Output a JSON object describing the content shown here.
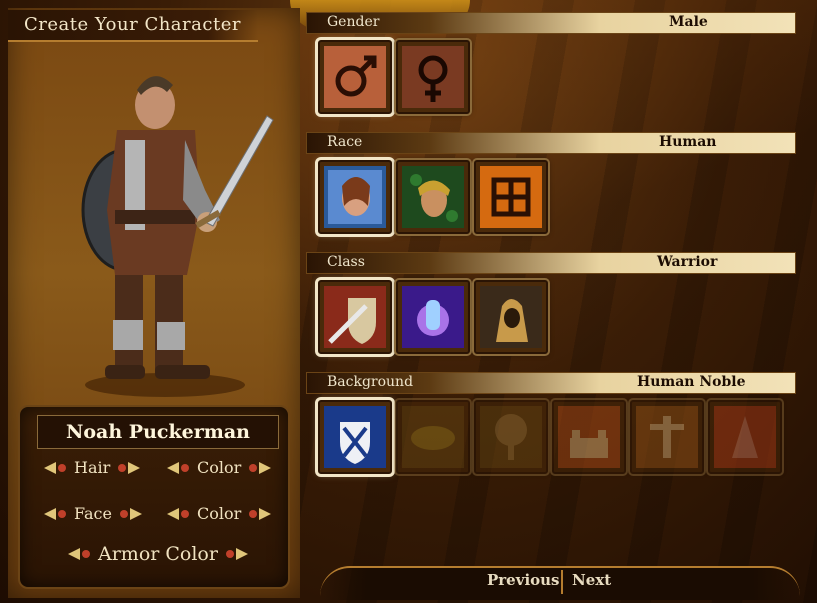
{
  "header": {
    "title": "Create Your Character"
  },
  "character": {
    "name": "Noah Puckerman",
    "options": {
      "hair": "Hair",
      "hair_color": "Color",
      "face": "Face",
      "face_color": "Color",
      "armor_color": "Armor Color"
    }
  },
  "sections": {
    "gender": {
      "label": "Gender",
      "value": "Male",
      "icons": [
        "male-symbol-icon",
        "female-symbol-icon"
      ],
      "selected": 0
    },
    "race": {
      "label": "Race",
      "value": "Human",
      "icons": [
        "human-portrait-icon",
        "elf-portrait-icon",
        "dwarf-portrait-icon"
      ],
      "selected": 0
    },
    "class": {
      "label": "Class",
      "value": "Warrior",
      "icons": [
        "sword-shield-icon",
        "magic-hand-icon",
        "hooded-rogue-icon"
      ],
      "selected": 0
    },
    "background": {
      "label": "Background",
      "value": "Human Noble",
      "icons": [
        "noble-crest-icon",
        "forest-mask-icon",
        "tree-icon",
        "castle-icon",
        "dwarf-glyph-icon",
        "mage-icon"
      ],
      "selected": 0
    }
  },
  "nav": {
    "previous": "Previous",
    "next": "Next"
  },
  "colors": {
    "accent": "#b57d2f",
    "panel": "#2a1404",
    "header_light": "#f2e2b8"
  }
}
